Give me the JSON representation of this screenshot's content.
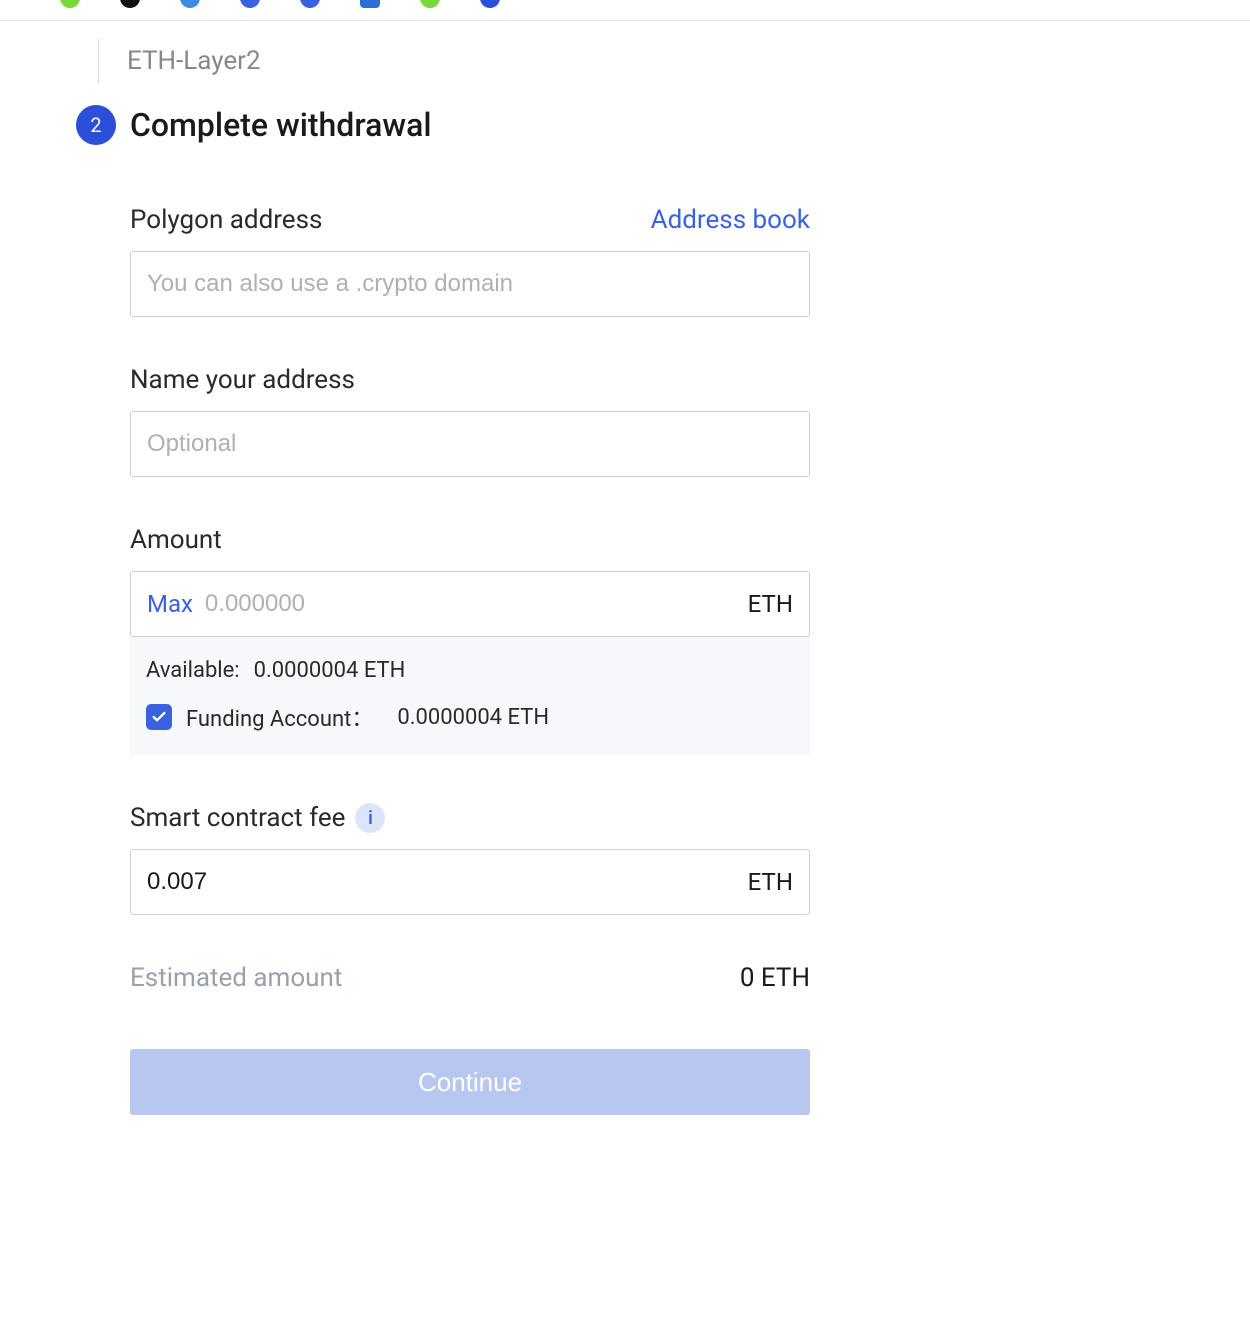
{
  "breadcrumb": "ETH-Layer2",
  "step": {
    "number": "2",
    "title": "Complete withdrawal"
  },
  "address_field": {
    "label": "Polygon address",
    "address_book_link": "Address book",
    "placeholder": "You can also use a .crypto domain",
    "value": ""
  },
  "name_field": {
    "label": "Name your address",
    "placeholder": "Optional",
    "value": ""
  },
  "amount_field": {
    "label": "Amount",
    "max_label": "Max",
    "placeholder": "0.000000",
    "value": "",
    "unit": "ETH"
  },
  "available": {
    "label": "Available:",
    "value": "0.0000004 ETH"
  },
  "funding_account": {
    "checked": true,
    "label": "Funding Account：",
    "value": "0.0000004 ETH"
  },
  "fee_field": {
    "label": "Smart contract fee",
    "value": "0.007",
    "unit": "ETH"
  },
  "estimated": {
    "label": "Estimated amount",
    "value": "0 ETH"
  },
  "continue_label": "Continue"
}
